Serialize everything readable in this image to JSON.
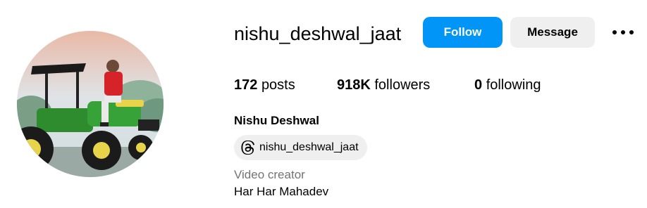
{
  "profile": {
    "username": "nishu_deshwal_jaat",
    "full_name": "Nishu Deshwal",
    "category": "Video creator",
    "bio": "Har Har Mahadev"
  },
  "actions": {
    "follow_label": "Follow",
    "message_label": "Message",
    "more_icon": "more-horizontal-icon"
  },
  "stats": {
    "posts_count": "172",
    "posts_label": "posts",
    "followers_count": "918K",
    "followers_label": "followers",
    "following_count": "0",
    "following_label": "following"
  },
  "threads_badge": {
    "icon": "threads-icon",
    "handle": "nishu_deshwal_jaat"
  },
  "colors": {
    "accent": "#0095f6",
    "secondary_button": "#efefef",
    "muted_text": "#737373"
  }
}
